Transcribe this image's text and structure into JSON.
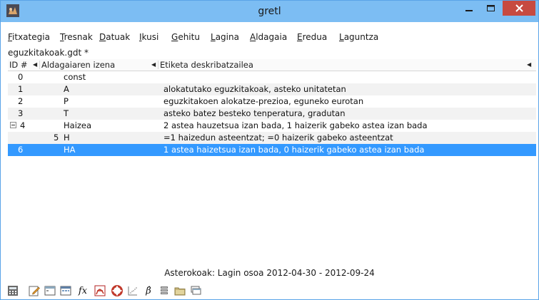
{
  "window": {
    "title": "gretl"
  },
  "menu": [
    {
      "label": "Fitxategia",
      "mn": "F",
      "rest": "itxategia"
    },
    {
      "label": "Tresnak",
      "mn": "T",
      "rest": "resnak"
    },
    {
      "label": "Datuak",
      "mn": "D",
      "rest": "atuak"
    },
    {
      "label": "Ikusi",
      "mn": "I",
      "rest": "kusi"
    },
    {
      "label": "Gehitu",
      "mn": "G",
      "rest": "ehitu"
    },
    {
      "label": "Lagina",
      "mn": "L",
      "rest": "agina"
    },
    {
      "label": "Aldagaia",
      "mn": "A",
      "rest": "ldagaia"
    },
    {
      "label": "Eredua",
      "mn": "E",
      "rest": "redua"
    },
    {
      "label": "Laguntza",
      "mn": "L",
      "rest": "aguntza"
    }
  ],
  "dataset": {
    "filename": "eguzkitakoak.gdt *"
  },
  "columns": {
    "id": "ID #",
    "name": "Aldagaiaren izena",
    "label": "Etiketa deskribatzailea"
  },
  "rows": [
    {
      "id": "0",
      "name": "const",
      "label": ""
    },
    {
      "id": "1",
      "name": "A",
      "label": "alokatutako eguzkitakoak, asteko unitatetan"
    },
    {
      "id": "2",
      "name": "P",
      "label": "eguzkitakoen alokatze-prezioa, eguneko eurotan"
    },
    {
      "id": "3",
      "name": "T",
      "label": "asteko batez besteko tenperatura, gradutan"
    },
    {
      "id": "4",
      "name": "Haizea",
      "label": "2 astea hauzetsua izan bada, 1 haizerik gabeko astea izan bada"
    },
    {
      "id": "5",
      "name": "H",
      "label": "=1 haizedun asteentzat; =0 haizerik gabeko asteentzat"
    },
    {
      "id": "6",
      "name": "HA",
      "label": "1 astea haizetsua izan bada, 0 haizerik gabeko astea izan bada"
    }
  ],
  "status": {
    "text": "Asterokoak: Lagin osoa 2012-04-30 - 2012-09-24"
  },
  "toolbar_icons": [
    "calculator-icon",
    "edit-script-icon",
    "terminal-icon",
    "session-icons-icon",
    "function-icon",
    "pdf-icon",
    "help-icon",
    "plot-icon",
    "beta-icon",
    "database-icon",
    "folder-icon",
    "windows-icon"
  ],
  "colors": {
    "titlebar": "#7cbdf3",
    "selection": "#3399ff",
    "close": "#c74a40"
  }
}
